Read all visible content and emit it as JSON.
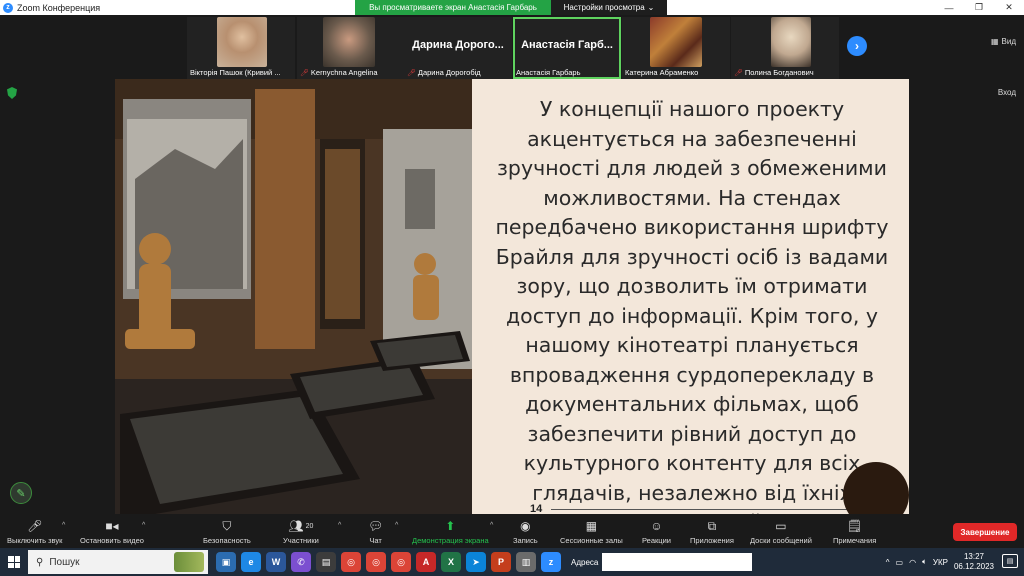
{
  "window": {
    "title": "Zoom Конференция",
    "share_banner": "Вы просматриваете экран Анастасія Гарбарь",
    "view_settings": "Настройки просмотра",
    "controls": [
      "—",
      "❐",
      "✕"
    ]
  },
  "participants": [
    {
      "label": "Вікторія Пашок (Кривий ...",
      "big_name": "",
      "muted": false,
      "has_video": true,
      "photo_color": "#c9b29a"
    },
    {
      "label": "Kernychna Angelina",
      "big_name": "",
      "muted": true,
      "has_video": true,
      "photo_color": "#7a6a5c"
    },
    {
      "label": "Дарина Дорогобід",
      "big_name": "Дарина Дорого...",
      "muted": true,
      "has_video": false
    },
    {
      "label": "Анастасія Гарбарь",
      "big_name": "Анастасія Гарб...",
      "muted": false,
      "has_video": false,
      "active": true
    },
    {
      "label": "Катерина Абраменко",
      "big_name": "",
      "muted": false,
      "has_video": true,
      "photo_color": "#8b3a2a"
    },
    {
      "label": "Полина Богданович",
      "big_name": "",
      "muted": true,
      "has_video": true,
      "photo_color": "#d8c8a8"
    }
  ],
  "view_button": "Вид",
  "exit_button": "Вход",
  "slide": {
    "text": "У концепції нашого проекту акцентується на забезпеченні зручності для людей з обмеженими можливостями. На стендах передбачено використання шрифту Брайля для зручності осіб із вадами зору, що дозволить їм отримати доступ до інформації. Крім того, у нашому кінотеатрі планується впровадження сурдоперекладу в документальних фільмах, щоб забезпечити рівний доступ до культурного контенту для всіх глядачів, незалежно від їхніх можливостей.",
    "page_number": "14"
  },
  "toolbar": {
    "mute": "Выключить звук",
    "video": "Остановить видео",
    "security": "Безопасность",
    "participants": "Участники",
    "participants_count": "20",
    "chat": "Чат",
    "share": "Демонстрация экрана",
    "record": "Запись",
    "breakout": "Сессионные залы",
    "reactions": "Реакции",
    "apps": "Приложения",
    "whiteboards": "Доски сообщений",
    "notes": "Примечания",
    "end": "Завершение"
  },
  "taskbar": {
    "search": "Пошук",
    "address_label": "Адреса",
    "language": "УКР",
    "time": "13:27",
    "date": "06.12.2023"
  }
}
